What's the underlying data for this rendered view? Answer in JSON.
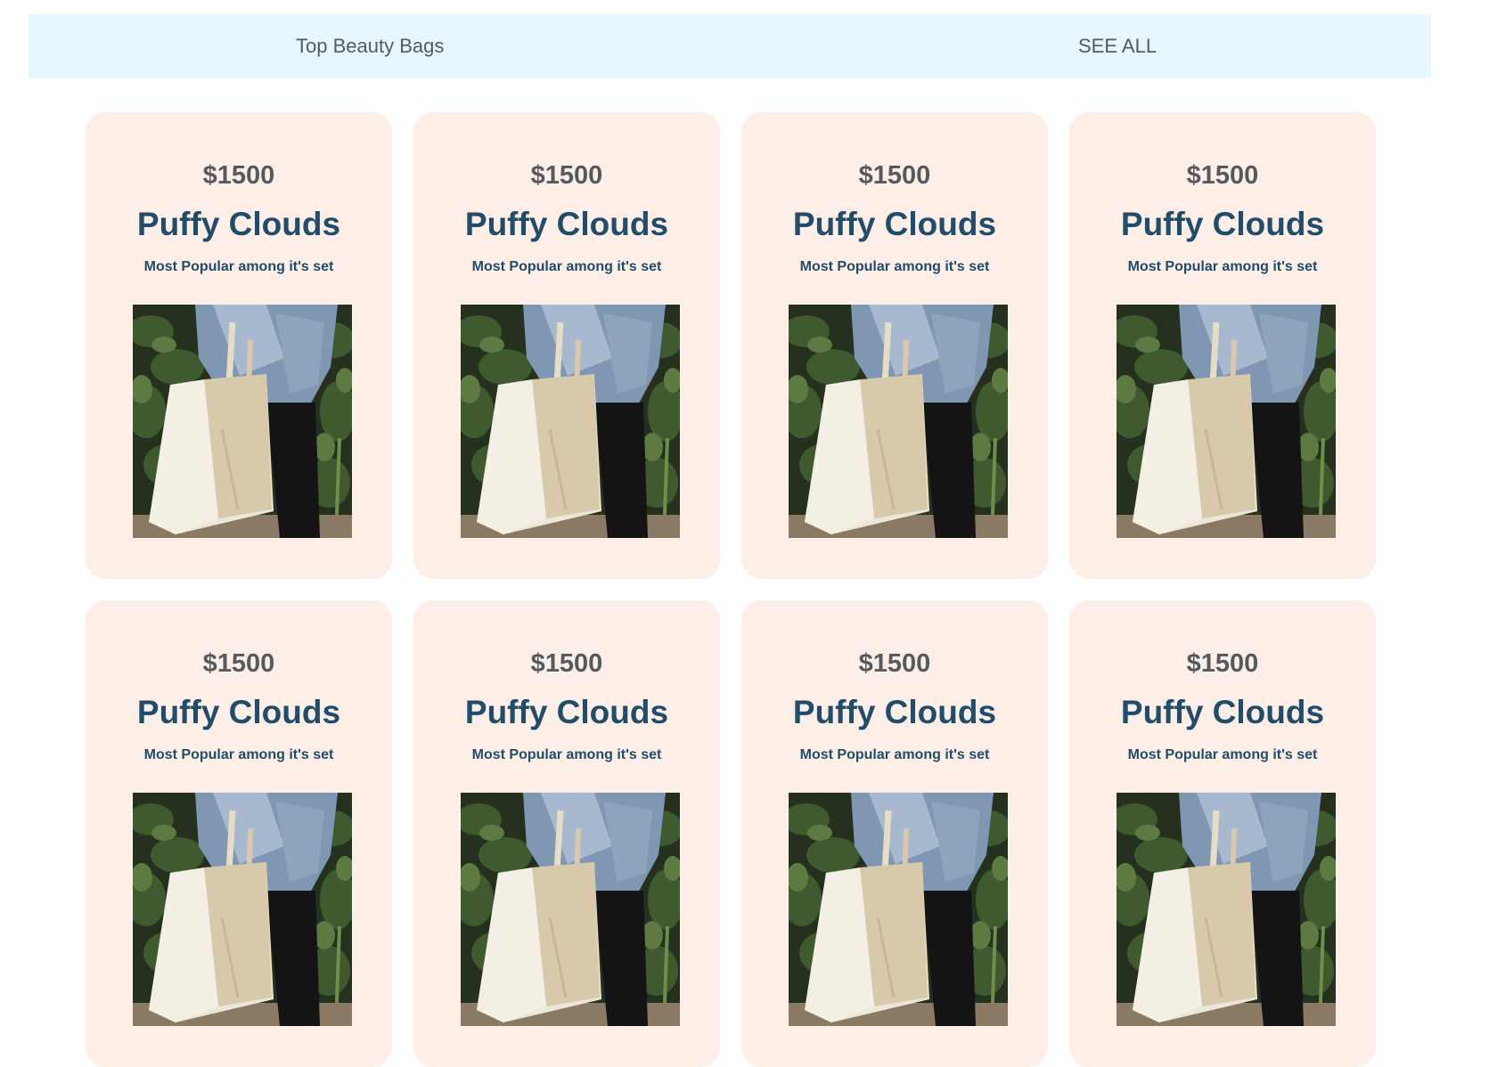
{
  "header": {
    "title": "Top Beauty Bags",
    "see_all_label": "SEE ALL"
  },
  "products": [
    {
      "price": "$1500",
      "name": "Puffy Clouds",
      "subtitle": "Most Popular among it's set",
      "image": "tote-bag-photo"
    },
    {
      "price": "$1500",
      "name": "Puffy Clouds",
      "subtitle": "Most Popular among it's set",
      "image": "tote-bag-photo"
    },
    {
      "price": "$1500",
      "name": "Puffy Clouds",
      "subtitle": "Most Popular among it's set",
      "image": "tote-bag-photo"
    },
    {
      "price": "$1500",
      "name": "Puffy Clouds",
      "subtitle": "Most Popular among it's set",
      "image": "tote-bag-photo"
    },
    {
      "price": "$1500",
      "name": "Puffy Clouds",
      "subtitle": "Most Popular among it's set",
      "image": "tote-bag-photo"
    },
    {
      "price": "$1500",
      "name": "Puffy Clouds",
      "subtitle": "Most Popular among it's set",
      "image": "tote-bag-photo"
    },
    {
      "price": "$1500",
      "name": "Puffy Clouds",
      "subtitle": "Most Popular among it's set",
      "image": "tote-bag-photo"
    },
    {
      "price": "$1500",
      "name": "Puffy Clouds",
      "subtitle": "Most Popular among it's set",
      "image": "tote-bag-photo"
    }
  ],
  "colors": {
    "header_bg": "#e8f6fe",
    "card_bg": "#fdeee7",
    "price_text": "#555a5e",
    "name_text": "#1f4d6a"
  }
}
